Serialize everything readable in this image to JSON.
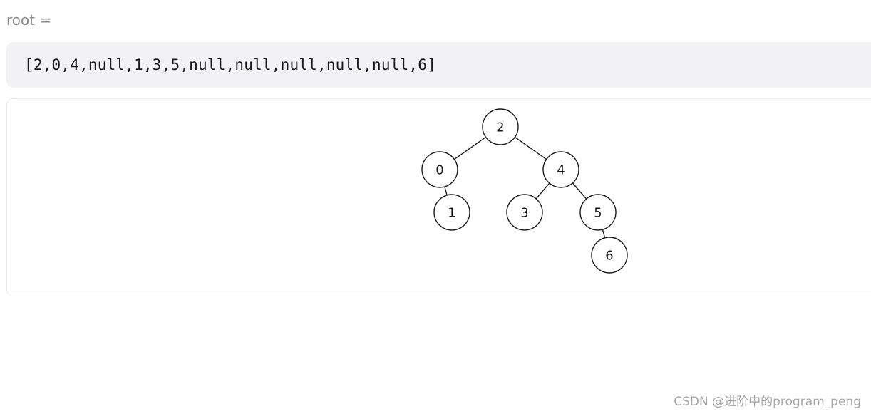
{
  "label": "root =",
  "array_text": "[2,0,4,null,1,3,5,null,null,null,null,null,6]",
  "tree": {
    "nodes": [
      {
        "id": "n2",
        "value": "2"
      },
      {
        "id": "n0",
        "value": "0"
      },
      {
        "id": "n4",
        "value": "4"
      },
      {
        "id": "n1",
        "value": "1"
      },
      {
        "id": "n3",
        "value": "3"
      },
      {
        "id": "n5",
        "value": "5"
      },
      {
        "id": "n6",
        "value": "6"
      }
    ],
    "edges": [
      [
        "n2",
        "n0"
      ],
      [
        "n2",
        "n4"
      ],
      [
        "n0",
        "n1"
      ],
      [
        "n4",
        "n3"
      ],
      [
        "n4",
        "n5"
      ],
      [
        "n5",
        "n6"
      ]
    ]
  },
  "watermark": "CSDN @进阶中的program_peng"
}
